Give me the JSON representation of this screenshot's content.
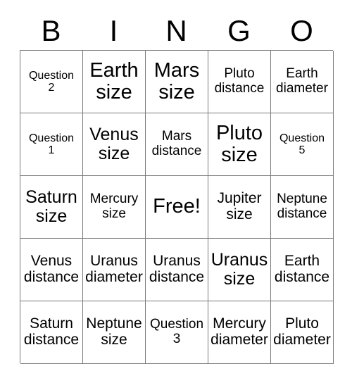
{
  "card": {
    "title_letters": [
      "B",
      "I",
      "N",
      "G",
      "O"
    ],
    "free_space_label": "Free!",
    "grid_line_color": "#7a7a7a",
    "text_color": "#000000",
    "background_color": "#ffffff",
    "rows": 5,
    "columns": 5
  },
  "cells": [
    [
      {
        "text": "Question\n2",
        "size": "xs"
      },
      {
        "text": "Earth\nsize",
        "size": "xl"
      },
      {
        "text": "Mars\nsize",
        "size": "xl"
      },
      {
        "text": "Pluto\ndistance",
        "size": "s"
      },
      {
        "text": "Earth\ndiameter",
        "size": "s"
      }
    ],
    [
      {
        "text": "Question\n1",
        "size": "xs"
      },
      {
        "text": "Venus\nsize",
        "size": "l"
      },
      {
        "text": "Mars\ndistance",
        "size": "s"
      },
      {
        "text": "Pluto\nsize",
        "size": "xl"
      },
      {
        "text": "Question\n5",
        "size": "xs"
      }
    ],
    [
      {
        "text": "Saturn\nsize",
        "size": "l"
      },
      {
        "text": "Mercury\nsize",
        "size": "s"
      },
      {
        "text": "Free!",
        "size": "xl"
      },
      {
        "text": "Jupiter\nsize",
        "size": "m"
      },
      {
        "text": "Neptune\ndistance",
        "size": "s"
      }
    ],
    [
      {
        "text": "Venus\ndistance",
        "size": "m"
      },
      {
        "text": "Uranus\ndiameter",
        "size": "m"
      },
      {
        "text": "Uranus\ndistance",
        "size": "m"
      },
      {
        "text": "Uranus\nsize",
        "size": "l"
      },
      {
        "text": "Earth\ndistance",
        "size": "m"
      }
    ],
    [
      {
        "text": "Saturn\ndistance",
        "size": "m"
      },
      {
        "text": "Neptune\nsize",
        "size": "m"
      },
      {
        "text": "Question\n3",
        "size": "s"
      },
      {
        "text": "Mercury\ndiameter",
        "size": "m"
      },
      {
        "text": "Pluto\ndiameter",
        "size": "m"
      }
    ]
  ]
}
